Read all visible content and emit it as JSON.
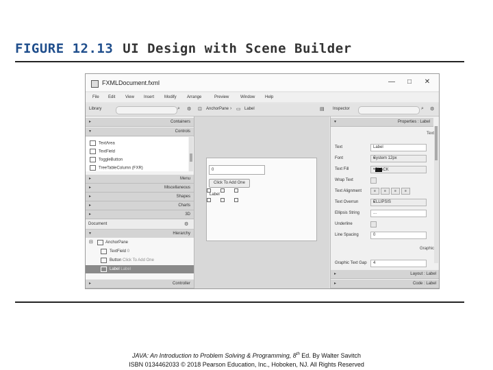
{
  "figure": {
    "number": "FIGURE 12.13",
    "subtitle": "UI Design with Scene Builder"
  },
  "window": {
    "title": "FXMLDocument.fxml",
    "minimize": "—",
    "maximize": "□",
    "close": "✕"
  },
  "menu": [
    "File",
    "Edit",
    "View",
    "Insert",
    "Modify",
    "Arrange",
    "Preview",
    "Window",
    "Help"
  ],
  "toolbar": {
    "library_label": "Library",
    "breadcrumb_1": "AnchorPane",
    "breadcrumb_2": "Label",
    "inspector_label": "Inspector"
  },
  "library": {
    "sections_top": [
      "Containers",
      "Controls"
    ],
    "items": [
      "TextArea",
      "TextField",
      "ToggleButton",
      "TreeTableColumn  (FXR)"
    ],
    "sections_bottom": [
      "Menu",
      "Miscellaneous",
      "Shapes",
      "Charts",
      "3D"
    ]
  },
  "document": {
    "title": "Document",
    "hierarchy_label": "Hierarchy",
    "rows": [
      {
        "type": "AnchorPane",
        "name": ""
      },
      {
        "type": "TextField",
        "name": "0"
      },
      {
        "type": "Button",
        "name": "Click To Add One"
      },
      {
        "type": "Label",
        "name": "Label"
      }
    ],
    "controller_label": "Controller"
  },
  "canvas": {
    "textfield_value": "0",
    "button_label": "Click To Add One",
    "label_text": "Label"
  },
  "inspector": {
    "properties_header": "Properties : Label",
    "subsection_text": "Text",
    "rows": [
      {
        "label": "Text",
        "value": "Label",
        "kind": "field"
      },
      {
        "label": "Font",
        "value": "System 12px",
        "kind": "drop"
      },
      {
        "label": "Text Fill",
        "value": "BLACK",
        "kind": "color"
      },
      {
        "label": "Wrap Text",
        "value": "",
        "kind": "check"
      },
      {
        "label": "Text Alignment",
        "value": "",
        "kind": "align"
      },
      {
        "label": "Text Overrun",
        "value": "ELLIPSIS",
        "kind": "drop"
      },
      {
        "label": "Ellipsis String",
        "value": "...",
        "kind": "field"
      },
      {
        "label": "Underline",
        "value": "",
        "kind": "check"
      },
      {
        "label": "Line Spacing",
        "value": "0",
        "kind": "field"
      }
    ],
    "subsection_graphic": "Graphic",
    "graphic_gap_label": "Graphic Text Gap",
    "graphic_gap_value": "4",
    "layout_header": "Layout : Label",
    "code_header": "Code : Label"
  },
  "caption": {
    "line1_pre": "JAVA: An Introduction to Problem Solving & Programming, 8",
    "line1_sup": "th",
    "line1_post": " Ed. By Walter Savitch",
    "line2": "ISBN 0134462033 © 2018 Pearson Education, Inc., Hoboken, NJ. All Rights Reserved"
  },
  "colors": {
    "figure_number": "#1f4e8c",
    "selected_row": "#8a8a8a"
  }
}
